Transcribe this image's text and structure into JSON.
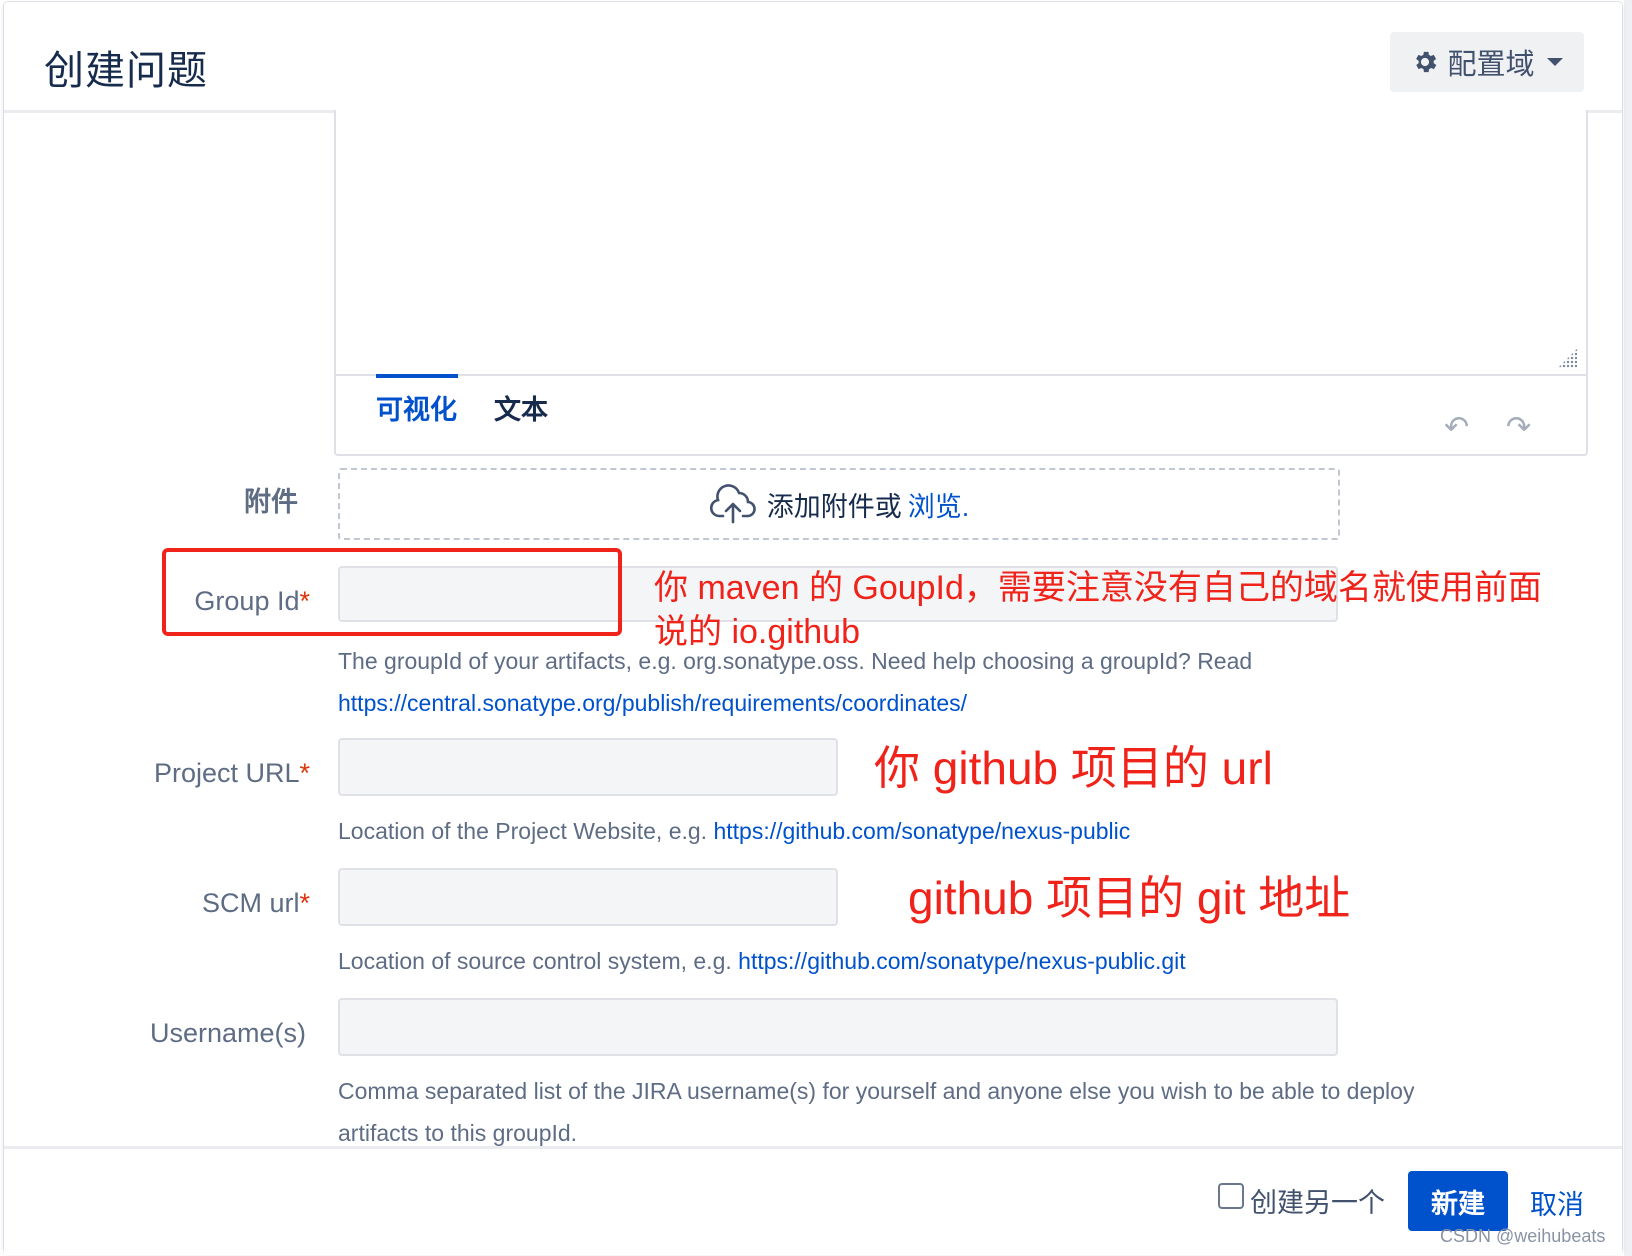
{
  "dialog": {
    "title": "创建问题",
    "config_button": "配置域"
  },
  "editor": {
    "tab_visual": "可视化",
    "tab_text": "文本"
  },
  "attachment": {
    "label": "附件",
    "drop_text": "添加附件或",
    "browse": "浏览."
  },
  "fields": {
    "group_id": {
      "label": "Group Id",
      "required": "*",
      "help_text": "The groupId of your artifacts, e.g. org.sonatype.oss. Need help choosing a groupId? Read",
      "help_link": "https://central.sonatype.org/publish/requirements/coordinates/"
    },
    "project_url": {
      "label": "Project URL",
      "required": "*",
      "help_text": "Location of the Project Website, e.g.",
      "help_link": "https://github.com/sonatype/nexus-public"
    },
    "scm_url": {
      "label": "SCM url",
      "required": "*",
      "help_text": "Location of source control system, e.g.",
      "help_link": "https://github.com/sonatype/nexus-public.git"
    },
    "usernames": {
      "label": "Username(s)",
      "help_line1": "Comma separated list of the JIRA username(s) for yourself and anyone else you wish to be able to deploy",
      "help_line2": "artifacts to this groupId."
    }
  },
  "annotations": {
    "group_id_line1": "你 maven 的 GoupId，需要注意没有自己的域名就使用前面",
    "group_id_line2": "说的 io.github",
    "project_url": "你 github 项目的 url",
    "scm_url": "github 项目的 git 地址",
    "color": "#f0231b"
  },
  "footer": {
    "create_another": "创建另一个",
    "create": "新建",
    "cancel": "取消"
  },
  "watermark": "CSDN @weihubeats",
  "colors": {
    "primary": "#0052cc",
    "required": "#de350b",
    "text": "#172b4d",
    "muted": "#5e6c84"
  }
}
